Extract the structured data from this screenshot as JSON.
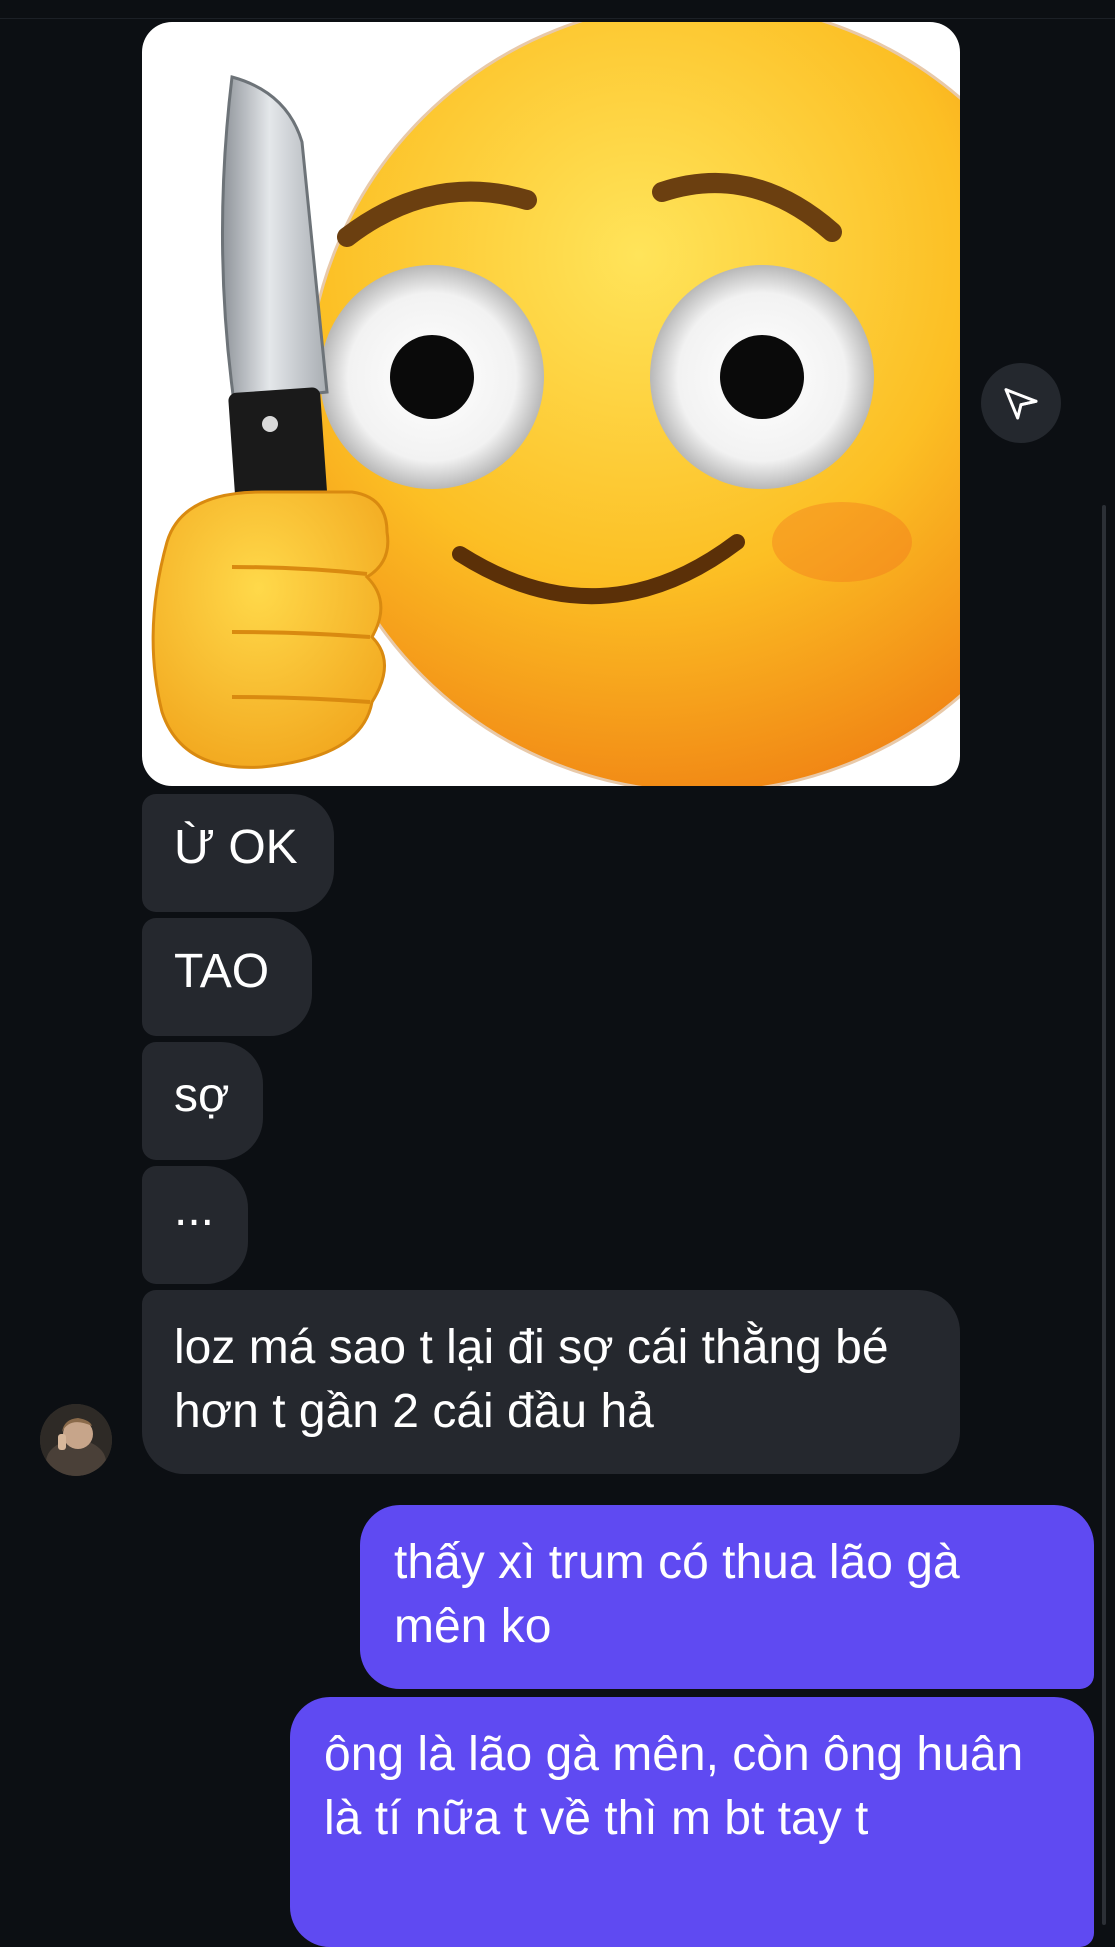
{
  "chat": {
    "incoming": [
      {
        "text": "Ừ OK"
      },
      {
        "text": "TAO"
      },
      {
        "text": "sợ"
      },
      {
        "text": "..."
      },
      {
        "text": "loz má sao t lại đi sợ cái thằng bé hơn t gần 2 cái đầu hả"
      }
    ],
    "outgoing": [
      {
        "text": "thấy xì trum có thua lão gà mên ko"
      },
      {
        "text": "ông là lão gà mên, còn ông huân là tí nữa t về thì m bt tay t"
      }
    ]
  },
  "colors": {
    "background": "#0c0f13",
    "incoming_bubble": "#25282e",
    "outgoing_bubble": "#5f4af2"
  },
  "icons": {
    "share": "send-icon",
    "sticker": "emoji-holding-knife"
  }
}
